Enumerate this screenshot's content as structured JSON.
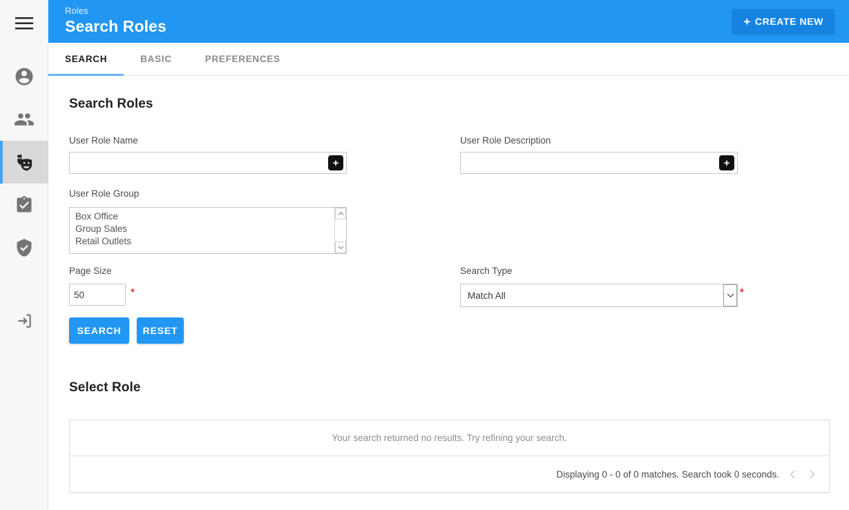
{
  "sidebar": {
    "items": [
      {
        "name": "menu-toggle",
        "icon": "hamburger-menu-icon",
        "active": false
      },
      {
        "name": "account-circle",
        "icon": "account-circle-icon",
        "active": false
      },
      {
        "name": "people",
        "icon": "people-icon",
        "active": false
      },
      {
        "name": "roles",
        "icon": "theater-masks-icon",
        "active": true
      },
      {
        "name": "assignments",
        "icon": "assignment-turned-in-icon",
        "active": false
      },
      {
        "name": "security",
        "icon": "shield-check-icon",
        "active": false
      },
      {
        "name": "logout",
        "icon": "exit-to-app-icon",
        "active": false
      }
    ]
  },
  "header": {
    "breadcrumb": "Roles",
    "title": "Search Roles",
    "create_new_label": "CREATE NEW",
    "create_new_plus": "+",
    "bg_color": "#2196f3",
    "button_color": "#1683e2"
  },
  "tabs": [
    {
      "label": "SEARCH",
      "active": true
    },
    {
      "label": "BASIC",
      "active": false
    },
    {
      "label": "PREFERENCES",
      "active": false
    }
  ],
  "main": {
    "search_section_title": "Search Roles",
    "select_section_title": "Select Role",
    "fields": {
      "user_role_name": {
        "label": "User Role Name",
        "value": "",
        "placeholder": "",
        "addon": "+"
      },
      "user_role_description": {
        "label": "User Role Description",
        "value": "",
        "placeholder": "",
        "addon": "+"
      },
      "user_role_group": {
        "label": "User Role Group",
        "options": [
          "Box Office",
          "Group Sales",
          "Retail Outlets"
        ]
      },
      "page_size": {
        "label": "Page Size",
        "value": "50",
        "required_marker": "*"
      },
      "search_type": {
        "label": "Search Type",
        "value": "Match All",
        "required_marker": "*"
      }
    },
    "buttons": {
      "search_label": "SEARCH",
      "reset_label": "RESET"
    },
    "results": {
      "empty_message": "Your search returned no results. Try refining your search.",
      "pagination_text": "Displaying 0 - 0 of 0 matches. Search took 0 seconds."
    }
  }
}
